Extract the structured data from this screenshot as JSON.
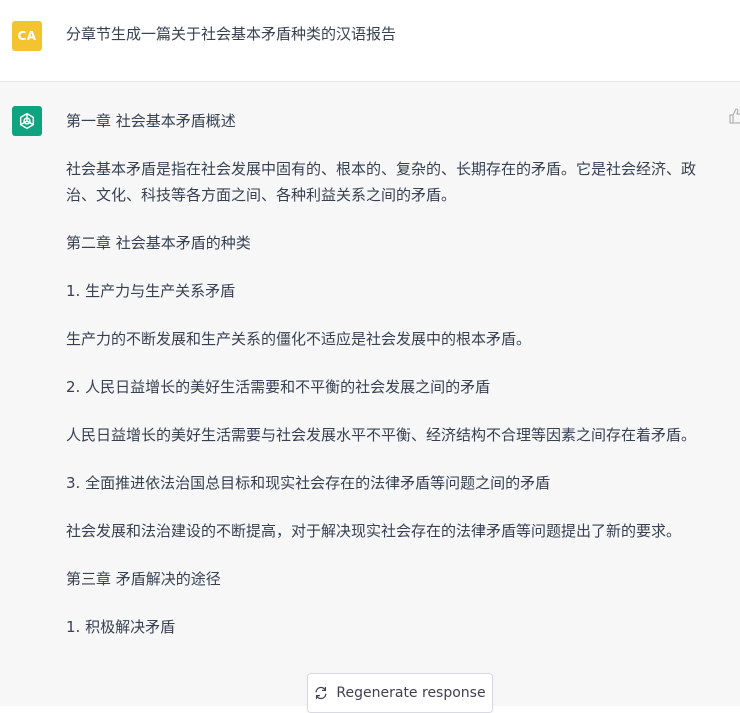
{
  "user": {
    "avatar_initials": "CA",
    "message": "分章节生成一篇关于社会基本矛盾种类的汉语报告"
  },
  "assistant": {
    "paragraphs": [
      "第一章 社会基本矛盾概述",
      "社会基本矛盾是指在社会发展中固有的、根本的、复杂的、长期存在的矛盾。它是社会经济、政治、文化、科技等各方面之间、各种利益关系之间的矛盾。",
      "第二章 社会基本矛盾的种类",
      "1. 生产力与生产关系矛盾",
      "生产力的不断发展和生产关系的僵化不适应是社会发展中的根本矛盾。",
      "2. 人民日益增长的美好生活需要和不平衡的社会发展之间的矛盾",
      "人民日益增长的美好生活需要与社会发展水平不平衡、经济结构不合理等因素之间存在着矛盾。",
      "3. 全面推进依法治国总目标和现实社会存在的法律矛盾等问题之间的矛盾",
      "社会发展和法治建设的不断提高，对于解决现实社会存在的法律矛盾等问题提出了新的要求。",
      "第三章 矛盾解决的途径",
      "1. 积极解决矛盾"
    ]
  },
  "controls": {
    "regenerate_label": "Regenerate response"
  },
  "colors": {
    "user_avatar": "#f4c430",
    "bot_avatar": "#10a37f",
    "assistant_bg": "#f7f7f8"
  },
  "icons": {
    "bot_avatar": "openai-logo-icon",
    "feedback": "thumbs-up-icon",
    "regenerate": "refresh-icon"
  }
}
